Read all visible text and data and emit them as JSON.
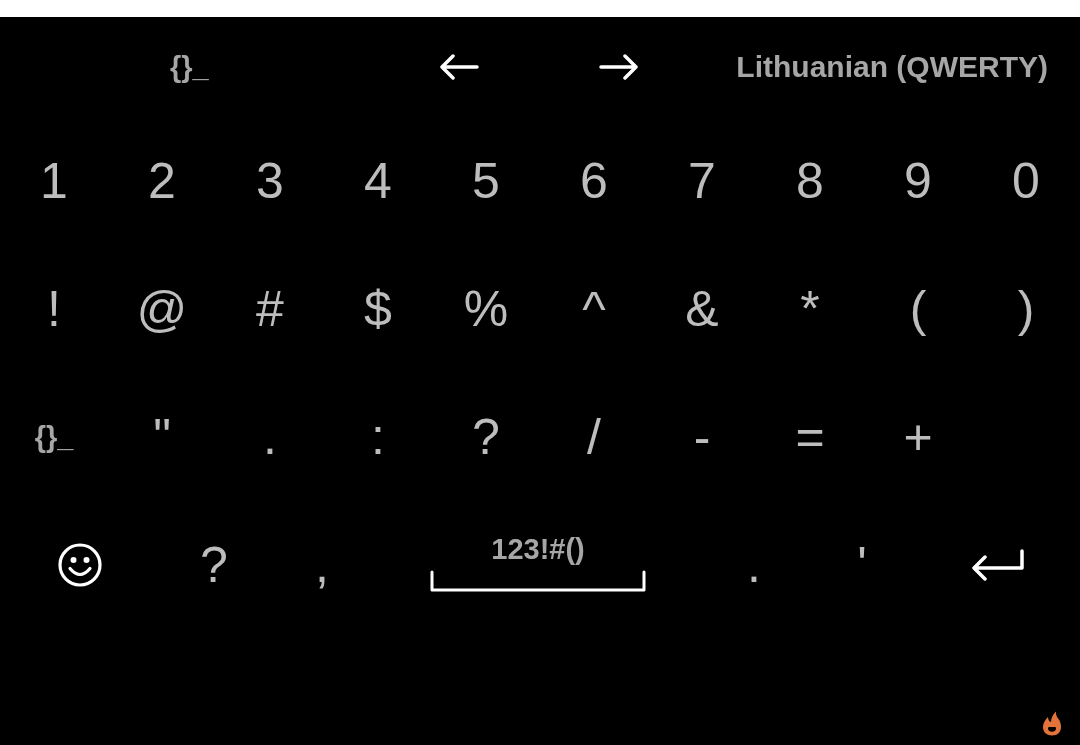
{
  "toolbar": {
    "symbols_key": "{}_",
    "language": "Lithuanian (QWERTY)"
  },
  "rows": [
    {
      "keys": [
        {
          "kind": "char",
          "label": "1"
        },
        {
          "kind": "char",
          "label": "2"
        },
        {
          "kind": "char",
          "label": "3"
        },
        {
          "kind": "char",
          "label": "4"
        },
        {
          "kind": "char",
          "label": "5"
        },
        {
          "kind": "char",
          "label": "6"
        },
        {
          "kind": "char",
          "label": "7"
        },
        {
          "kind": "char",
          "label": "8"
        },
        {
          "kind": "char",
          "label": "9"
        },
        {
          "kind": "char",
          "label": "0"
        }
      ]
    },
    {
      "keys": [
        {
          "kind": "char",
          "label": "!"
        },
        {
          "kind": "char",
          "label": "@"
        },
        {
          "kind": "char",
          "label": "#"
        },
        {
          "kind": "char",
          "label": "$"
        },
        {
          "kind": "char",
          "label": "%"
        },
        {
          "kind": "char",
          "label": "^"
        },
        {
          "kind": "char",
          "label": "&"
        },
        {
          "kind": "char",
          "label": "*"
        },
        {
          "kind": "char",
          "label": "("
        },
        {
          "kind": "char",
          "label": ")"
        }
      ]
    },
    {
      "keys": [
        {
          "kind": "mode",
          "label": "{}_"
        },
        {
          "kind": "char",
          "label": "\""
        },
        {
          "kind": "char",
          "label": "."
        },
        {
          "kind": "char",
          "label": ":"
        },
        {
          "kind": "char",
          "label": "?"
        },
        {
          "kind": "char",
          "label": "/"
        },
        {
          "kind": "char",
          "label": "-"
        },
        {
          "kind": "char",
          "label": "="
        },
        {
          "kind": "char",
          "label": "+"
        }
      ]
    },
    {
      "keys": [
        {
          "kind": "emoji"
        },
        {
          "kind": "char",
          "label": "?"
        },
        {
          "kind": "char",
          "label": ","
        },
        {
          "kind": "space",
          "label": "123!#()"
        },
        {
          "kind": "char",
          "label": "."
        },
        {
          "kind": "char",
          "label": "'"
        },
        {
          "kind": "enter"
        }
      ]
    }
  ]
}
